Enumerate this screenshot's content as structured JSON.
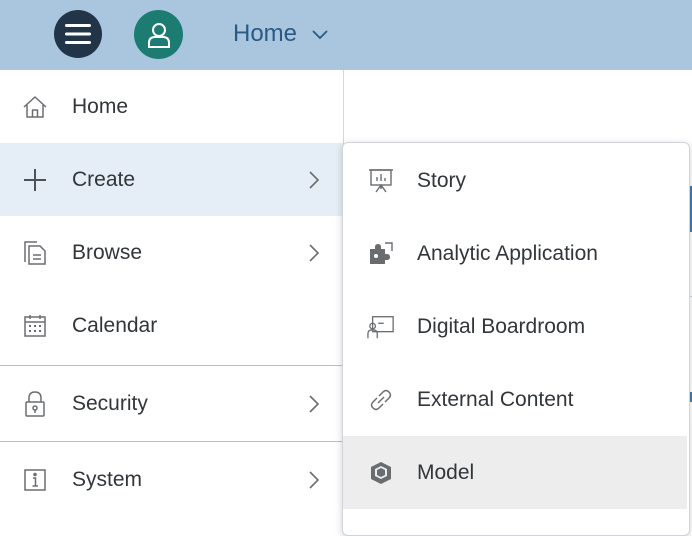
{
  "header": {
    "menu_icon": "hamburger-menu-icon",
    "avatar_icon": "person-icon",
    "title": "Home",
    "title_icon": "chevron-down-icon"
  },
  "colors": {
    "header_bg": "#a9c6de",
    "menu_button": "#223548",
    "avatar_bg": "#1c7c72",
    "title_text": "#2a5985",
    "active_item_bg": "#e5eef6",
    "hover_item_bg": "#ededed"
  },
  "nav": {
    "items": [
      {
        "label": "Home",
        "icon": "home-icon"
      },
      {
        "label": "Create",
        "icon": "plus-icon",
        "has_submenu": true,
        "active": true
      },
      {
        "label": "Browse",
        "icon": "documents-icon",
        "has_submenu": true
      },
      {
        "label": "Calendar",
        "icon": "calendar-icon"
      },
      {
        "label": "Security",
        "icon": "lock-icon",
        "has_submenu": true
      },
      {
        "label": "System",
        "icon": "info-icon",
        "has_submenu": true
      }
    ]
  },
  "submenu": {
    "items": [
      {
        "label": "Story",
        "icon": "presentation-chart-icon"
      },
      {
        "label": "Analytic Application",
        "icon": "puzzle-icon"
      },
      {
        "label": "Digital Boardroom",
        "icon": "boardroom-icon"
      },
      {
        "label": "External Content",
        "icon": "link-icon"
      },
      {
        "label": "Model",
        "icon": "cube-icon",
        "hovered": true
      }
    ]
  }
}
